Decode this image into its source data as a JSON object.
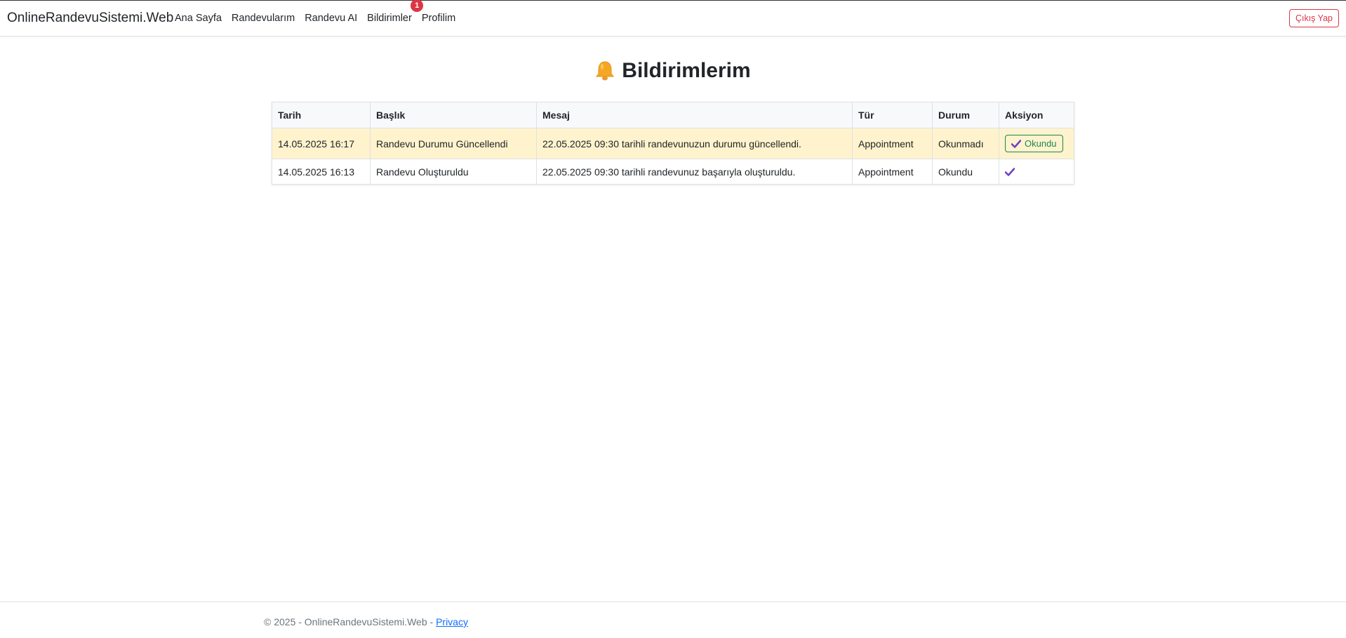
{
  "app": {
    "brand": "OnlineRandevuSistemi.Web",
    "nav": [
      {
        "label": "Ana Sayfa"
      },
      {
        "label": "Randevularım"
      },
      {
        "label": "Randevu AI"
      },
      {
        "label": "Bildirimler",
        "badge": "1"
      },
      {
        "label": "Profilim"
      }
    ],
    "logout_label": "Çıkış Yap"
  },
  "page": {
    "title": "Bildirimlerim",
    "title_icon": "bell-icon"
  },
  "table": {
    "headers": [
      "Tarih",
      "Başlık",
      "Mesaj",
      "Tür",
      "Durum",
      "Aksiyon"
    ],
    "rows": [
      {
        "date": "14.05.2025 16:17",
        "title": "Randevu Durumu Güncellendi",
        "message": "22.05.2025 09:30 tarihli randevunuzun durumu güncellendi.",
        "type": "Appointment",
        "status": "Okunmadı",
        "action_label": "Okundu",
        "action_icon": "check-icon"
      },
      {
        "date": "14.05.2025 16:13",
        "title": "Randevu Oluşturuldu",
        "message": "22.05.2025 09:30 tarihli randevunuz başarıyla oluşturuldu.",
        "type": "Appointment",
        "status": "Okundu",
        "action_icon": "check-icon"
      }
    ]
  },
  "footer": {
    "text": "© 2025 - OnlineRandevuSistemi.Web - ",
    "privacy_link": "Privacy"
  },
  "colors": {
    "danger": "#dc3545",
    "success": "#198754",
    "unread_row": "#fff3cd",
    "check": "#6f42c1"
  }
}
